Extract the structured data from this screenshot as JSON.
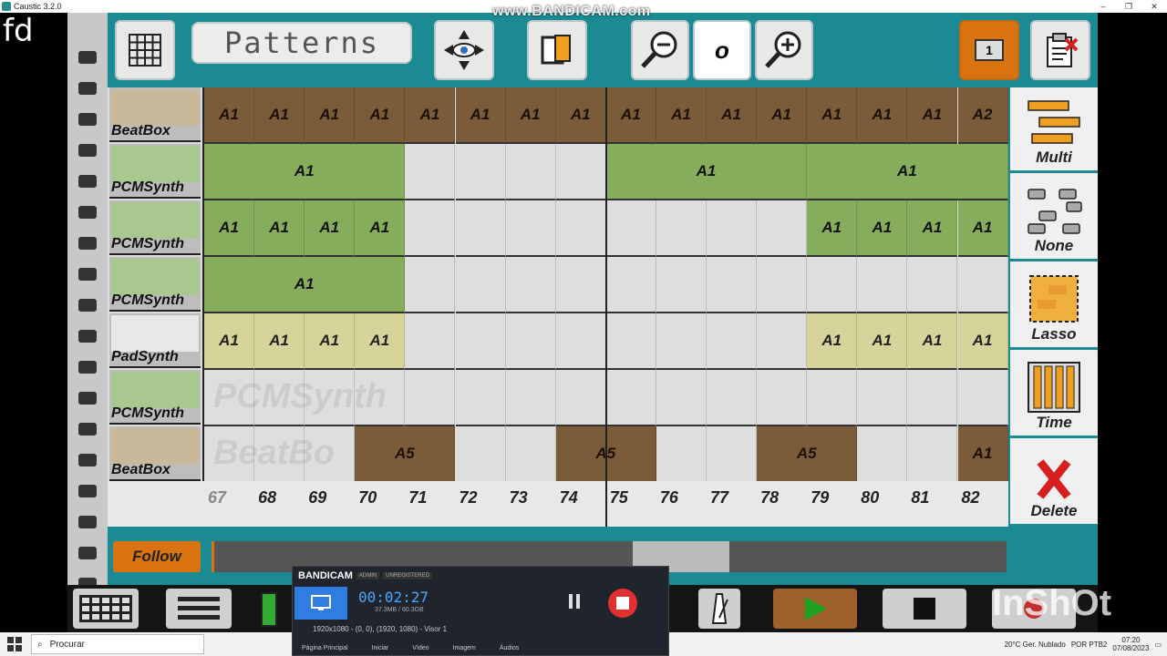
{
  "window": {
    "title": "Caustic 3.2.0",
    "controls": [
      "–",
      "❐",
      "✕"
    ]
  },
  "overlay": {
    "corner_text": "fd",
    "watermark": "www.BANDICAM.com",
    "inshot": "InShOt"
  },
  "toolbar": {
    "mode_label": "Patterns",
    "zoom_value": "o",
    "counter": "1"
  },
  "tracks": [
    {
      "name": "BeatBox",
      "color": "brown"
    },
    {
      "name": "PCMSynth",
      "color": "green"
    },
    {
      "name": "PCMSynth",
      "color": "green"
    },
    {
      "name": "PCMSynth",
      "color": "green"
    },
    {
      "name": "PadSynth",
      "color": "yellow"
    },
    {
      "name": "PCMSynth",
      "color": "green"
    },
    {
      "name": "BeatBox",
      "color": "brown"
    }
  ],
  "pattern_rows": [
    [
      "A1",
      "A1",
      "A1",
      "A1",
      "A1",
      "A1",
      "A1",
      "A1",
      "A1",
      "A1",
      "A1",
      "A1",
      "A1",
      "A1",
      "A1",
      "A2"
    ],
    [
      "A1",
      "A1",
      "A1"
    ],
    [
      "A1",
      "A1",
      "A1",
      "A1",
      "A1",
      "A1",
      "A1",
      "A1"
    ],
    [
      "A1"
    ],
    [
      "A1",
      "A1",
      "A1",
      "A1",
      "A1",
      "A1",
      "A1",
      "A1"
    ],
    [],
    [
      "A5",
      "A5",
      "A5",
      "A1"
    ]
  ],
  "ghost_labels": [
    "PCMSynth",
    "BeatBo"
  ],
  "ruler": [
    "67",
    "68",
    "69",
    "70",
    "71",
    "72",
    "73",
    "74",
    "75",
    "76",
    "77",
    "78",
    "79",
    "80",
    "81",
    "82"
  ],
  "right_panel": [
    "Multi",
    "None",
    "Lasso",
    "Time",
    "Delete"
  ],
  "follow_label": "Follow",
  "bandicam": {
    "brand": "BANDICAM",
    "tag1": "ADMIN",
    "tag2": "UNREGISTERED",
    "timer": "00:02:27",
    "size": "37.3MB / 60.3GB",
    "resolution": "1920x1080 - (0, 0), (1920, 1080) - Visor 1",
    "tabs": [
      "Página Principal",
      "Iniciar",
      "Vídeo",
      "Imagem",
      "Áudios"
    ]
  },
  "taskbar": {
    "search_placeholder": "Procurar",
    "weather": "20°C  Ger. Nublado",
    "lang": "POR PTB2",
    "time": "07:20",
    "date": "07/08/2023"
  },
  "colors": {
    "brown": "#7a5b3a",
    "green": "#86ad5c",
    "yellow": "#d6d49a",
    "teal": "#1b8a93",
    "orange": "#d9730f"
  }
}
